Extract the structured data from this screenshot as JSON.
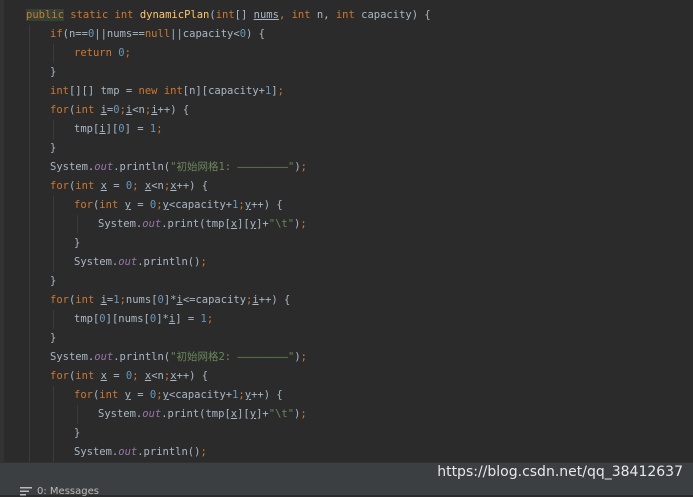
{
  "editor": {
    "lines": [
      {
        "indent": 0,
        "tokens": [
          {
            "t": "public",
            "c": "kw hl"
          },
          {
            "t": " ",
            "c": "plain"
          },
          {
            "t": "static",
            "c": "kw"
          },
          {
            "t": " ",
            "c": "plain"
          },
          {
            "t": "int",
            "c": "kw"
          },
          {
            "t": " ",
            "c": "plain"
          },
          {
            "t": "dynamicPlan",
            "c": "fn"
          },
          {
            "t": "(",
            "c": "plain"
          },
          {
            "t": "int",
            "c": "kw"
          },
          {
            "t": "[] ",
            "c": "plain"
          },
          {
            "t": "nums",
            "c": "under"
          },
          {
            "t": ", ",
            "c": "punct"
          },
          {
            "t": "int",
            "c": "kw"
          },
          {
            "t": " n, ",
            "c": "plain"
          },
          {
            "t": "int",
            "c": "kw"
          },
          {
            "t": " capacity) {",
            "c": "plain"
          }
        ]
      },
      {
        "indent": 1,
        "tokens": [
          {
            "t": "if",
            "c": "kw"
          },
          {
            "t": "(n==",
            "c": "plain"
          },
          {
            "t": "0",
            "c": "num"
          },
          {
            "t": "||nums==",
            "c": "plain"
          },
          {
            "t": "null",
            "c": "kw"
          },
          {
            "t": "||capacity<",
            "c": "plain"
          },
          {
            "t": "0",
            "c": "num"
          },
          {
            "t": ") {",
            "c": "plain"
          }
        ]
      },
      {
        "indent": 2,
        "tokens": [
          {
            "t": "return",
            "c": "kw"
          },
          {
            "t": " ",
            "c": "plain"
          },
          {
            "t": "0",
            "c": "num"
          },
          {
            "t": ";",
            "c": "punct"
          }
        ]
      },
      {
        "indent": 1,
        "tokens": [
          {
            "t": "}",
            "c": "plain"
          }
        ]
      },
      {
        "indent": 1,
        "tokens": [
          {
            "t": "int",
            "c": "kw"
          },
          {
            "t": "[][] tmp = ",
            "c": "plain"
          },
          {
            "t": "new",
            "c": "kw"
          },
          {
            "t": " ",
            "c": "plain"
          },
          {
            "t": "int",
            "c": "kw"
          },
          {
            "t": "[n][capacity+",
            "c": "plain"
          },
          {
            "t": "1",
            "c": "num"
          },
          {
            "t": "]",
            "c": "plain"
          },
          {
            "t": ";",
            "c": "punct"
          }
        ]
      },
      {
        "indent": 1,
        "tokens": [
          {
            "t": "for",
            "c": "kw"
          },
          {
            "t": "(",
            "c": "plain"
          },
          {
            "t": "int",
            "c": "kw"
          },
          {
            "t": " ",
            "c": "plain"
          },
          {
            "t": "i",
            "c": "var"
          },
          {
            "t": "=",
            "c": "plain"
          },
          {
            "t": "0",
            "c": "num"
          },
          {
            "t": ";",
            "c": "punct"
          },
          {
            "t": "i",
            "c": "var"
          },
          {
            "t": "<n",
            "c": "plain"
          },
          {
            "t": ";",
            "c": "punct"
          },
          {
            "t": "i",
            "c": "var"
          },
          {
            "t": "++) {",
            "c": "plain"
          }
        ]
      },
      {
        "indent": 2,
        "tokens": [
          {
            "t": "tmp[",
            "c": "plain"
          },
          {
            "t": "i",
            "c": "var"
          },
          {
            "t": "][",
            "c": "plain"
          },
          {
            "t": "0",
            "c": "num"
          },
          {
            "t": "] = ",
            "c": "plain"
          },
          {
            "t": "1",
            "c": "num"
          },
          {
            "t": ";",
            "c": "punct"
          }
        ]
      },
      {
        "indent": 1,
        "tokens": [
          {
            "t": "}",
            "c": "plain"
          }
        ]
      },
      {
        "indent": 1,
        "tokens": [
          {
            "t": "System.",
            "c": "plain"
          },
          {
            "t": "out",
            "c": "field"
          },
          {
            "t": ".println(",
            "c": "plain"
          },
          {
            "t": "\"初始网格1: ————————\"",
            "c": "str"
          },
          {
            "t": ")",
            "c": "plain"
          },
          {
            "t": ";",
            "c": "punct"
          }
        ]
      },
      {
        "indent": 1,
        "tokens": [
          {
            "t": "for",
            "c": "kw"
          },
          {
            "t": "(",
            "c": "plain"
          },
          {
            "t": "int",
            "c": "kw"
          },
          {
            "t": " ",
            "c": "plain"
          },
          {
            "t": "x",
            "c": "var"
          },
          {
            "t": " = ",
            "c": "plain"
          },
          {
            "t": "0",
            "c": "num"
          },
          {
            "t": "; ",
            "c": "punct"
          },
          {
            "t": "x",
            "c": "var"
          },
          {
            "t": "<n",
            "c": "plain"
          },
          {
            "t": ";",
            "c": "punct"
          },
          {
            "t": "x",
            "c": "var"
          },
          {
            "t": "++) {",
            "c": "plain"
          }
        ]
      },
      {
        "indent": 2,
        "tokens": [
          {
            "t": "for",
            "c": "kw"
          },
          {
            "t": "(",
            "c": "plain"
          },
          {
            "t": "int",
            "c": "kw"
          },
          {
            "t": " ",
            "c": "plain"
          },
          {
            "t": "y",
            "c": "var"
          },
          {
            "t": " = ",
            "c": "plain"
          },
          {
            "t": "0",
            "c": "num"
          },
          {
            "t": ";",
            "c": "punct"
          },
          {
            "t": "y",
            "c": "var"
          },
          {
            "t": "<capacity+",
            "c": "plain"
          },
          {
            "t": "1",
            "c": "num"
          },
          {
            "t": ";",
            "c": "punct"
          },
          {
            "t": "y",
            "c": "var"
          },
          {
            "t": "++) {",
            "c": "plain"
          }
        ]
      },
      {
        "indent": 3,
        "tokens": [
          {
            "t": "System.",
            "c": "plain"
          },
          {
            "t": "out",
            "c": "field"
          },
          {
            "t": ".print(tmp[",
            "c": "plain"
          },
          {
            "t": "x",
            "c": "var"
          },
          {
            "t": "][",
            "c": "plain"
          },
          {
            "t": "y",
            "c": "var"
          },
          {
            "t": "]+",
            "c": "plain"
          },
          {
            "t": "\"\\t\"",
            "c": "str"
          },
          {
            "t": ")",
            "c": "plain"
          },
          {
            "t": ";",
            "c": "punct"
          }
        ]
      },
      {
        "indent": 2,
        "tokens": [
          {
            "t": "}",
            "c": "plain"
          }
        ]
      },
      {
        "indent": 2,
        "tokens": [
          {
            "t": "System.",
            "c": "plain"
          },
          {
            "t": "out",
            "c": "field"
          },
          {
            "t": ".println()",
            "c": "plain"
          },
          {
            "t": ";",
            "c": "punct"
          }
        ]
      },
      {
        "indent": 1,
        "tokens": [
          {
            "t": "}",
            "c": "plain"
          }
        ]
      },
      {
        "indent": 1,
        "tokens": [
          {
            "t": "for",
            "c": "kw"
          },
          {
            "t": "(",
            "c": "plain"
          },
          {
            "t": "int",
            "c": "kw"
          },
          {
            "t": " ",
            "c": "plain"
          },
          {
            "t": "i",
            "c": "var"
          },
          {
            "t": "=",
            "c": "plain"
          },
          {
            "t": "1",
            "c": "num"
          },
          {
            "t": ";",
            "c": "punct"
          },
          {
            "t": "nums[",
            "c": "plain"
          },
          {
            "t": "0",
            "c": "num"
          },
          {
            "t": "]*",
            "c": "plain"
          },
          {
            "t": "i",
            "c": "var"
          },
          {
            "t": "<=capacity",
            "c": "plain"
          },
          {
            "t": ";",
            "c": "punct"
          },
          {
            "t": "i",
            "c": "var"
          },
          {
            "t": "++) {",
            "c": "plain"
          }
        ]
      },
      {
        "indent": 2,
        "tokens": [
          {
            "t": "tmp[",
            "c": "plain"
          },
          {
            "t": "0",
            "c": "num"
          },
          {
            "t": "][nums[",
            "c": "plain"
          },
          {
            "t": "0",
            "c": "num"
          },
          {
            "t": "]*",
            "c": "plain"
          },
          {
            "t": "i",
            "c": "var"
          },
          {
            "t": "] = ",
            "c": "plain"
          },
          {
            "t": "1",
            "c": "num"
          },
          {
            "t": ";",
            "c": "punct"
          }
        ]
      },
      {
        "indent": 1,
        "tokens": [
          {
            "t": "}",
            "c": "plain"
          }
        ]
      },
      {
        "indent": 1,
        "tokens": [
          {
            "t": "System.",
            "c": "plain"
          },
          {
            "t": "out",
            "c": "field"
          },
          {
            "t": ".println(",
            "c": "plain"
          },
          {
            "t": "\"初始网格2: ————————\"",
            "c": "str"
          },
          {
            "t": ")",
            "c": "plain"
          },
          {
            "t": ";",
            "c": "punct"
          }
        ]
      },
      {
        "indent": 1,
        "tokens": [
          {
            "t": "for",
            "c": "kw"
          },
          {
            "t": "(",
            "c": "plain"
          },
          {
            "t": "int",
            "c": "kw"
          },
          {
            "t": " ",
            "c": "plain"
          },
          {
            "t": "x",
            "c": "var"
          },
          {
            "t": " = ",
            "c": "plain"
          },
          {
            "t": "0",
            "c": "num"
          },
          {
            "t": "; ",
            "c": "punct"
          },
          {
            "t": "x",
            "c": "var"
          },
          {
            "t": "<n",
            "c": "plain"
          },
          {
            "t": ";",
            "c": "punct"
          },
          {
            "t": "x",
            "c": "var"
          },
          {
            "t": "++) {",
            "c": "plain"
          }
        ]
      },
      {
        "indent": 2,
        "tokens": [
          {
            "t": "for",
            "c": "kw"
          },
          {
            "t": "(",
            "c": "plain"
          },
          {
            "t": "int",
            "c": "kw"
          },
          {
            "t": " ",
            "c": "plain"
          },
          {
            "t": "y",
            "c": "var"
          },
          {
            "t": " = ",
            "c": "plain"
          },
          {
            "t": "0",
            "c": "num"
          },
          {
            "t": ";",
            "c": "punct"
          },
          {
            "t": "y",
            "c": "var"
          },
          {
            "t": "<capacity+",
            "c": "plain"
          },
          {
            "t": "1",
            "c": "num"
          },
          {
            "t": ";",
            "c": "punct"
          },
          {
            "t": "y",
            "c": "var"
          },
          {
            "t": "++) {",
            "c": "plain"
          }
        ]
      },
      {
        "indent": 3,
        "tokens": [
          {
            "t": "System.",
            "c": "plain"
          },
          {
            "t": "out",
            "c": "field"
          },
          {
            "t": ".print(tmp[",
            "c": "plain"
          },
          {
            "t": "x",
            "c": "var"
          },
          {
            "t": "][",
            "c": "plain"
          },
          {
            "t": "y",
            "c": "var"
          },
          {
            "t": "]+",
            "c": "plain"
          },
          {
            "t": "\"\\t\"",
            "c": "str"
          },
          {
            "t": ")",
            "c": "plain"
          },
          {
            "t": ";",
            "c": "punct"
          }
        ]
      },
      {
        "indent": 2,
        "tokens": [
          {
            "t": "}",
            "c": "plain"
          }
        ]
      },
      {
        "indent": 2,
        "tokens": [
          {
            "t": "System.",
            "c": "plain"
          },
          {
            "t": "out",
            "c": "field"
          },
          {
            "t": ".println()",
            "c": "plain"
          },
          {
            "t": ";",
            "c": "punct"
          }
        ]
      }
    ]
  },
  "bottom_bar": {
    "messages_tab_label": "0: Messages",
    "messages_icon": "list-icon"
  },
  "watermark": {
    "text": "https://blog.csdn.net/qq_38412637"
  },
  "colors": {
    "background": "#2b2b2b",
    "keyword": "#cc7832",
    "function": "#ffc66d",
    "number": "#6897bb",
    "string": "#6a8759",
    "field": "#9876aa",
    "text": "#a9b7c6"
  }
}
